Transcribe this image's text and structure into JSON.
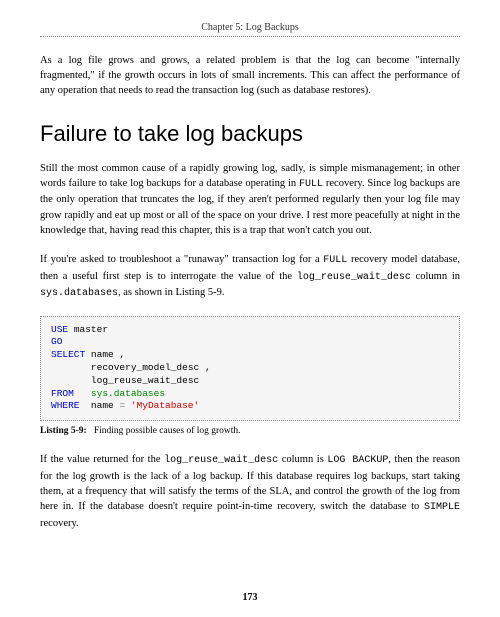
{
  "chapter_header": "Chapter 5: Log Backups",
  "intro": "As a log file grows and grows, a related problem is that the log can become \"internally fragmented,\" if the growth occurs in lots of small increments. This can affect the performance of any operation that needs to read the transaction log (such as database restores).",
  "heading": "Failure to take log backups",
  "para1_a": "Still the most common cause of a rapidly growing log, sadly, is simple mismanagement; in other words failure to take log backups for a database operating in ",
  "para1_code1": "FULL",
  "para1_b": " recovery. Since log backups are the only operation that truncates the log, if they aren't performed regularly then your log file may grow rapidly and eat up most or all of the space on your drive. I rest more peacefully at night in the knowledge that, having read this chapter, this is a trap that won't catch you out.",
  "para2_a": "If you're asked to troubleshoot a \"runaway\" transaction log for a ",
  "para2_code1": "FULL",
  "para2_b": " recovery model database, then a useful first step is to interrogate the value of the ",
  "para2_code2": "log_reuse_wait_desc",
  "para2_c": " column in ",
  "para2_code3": "sys.databases",
  "para2_d": ", as shown in Listing 5-9.",
  "code": {
    "use": "USE",
    "master": "master",
    "go": "GO",
    "select": "SELECT",
    "name_col": "name ,",
    "rmd_col": "recovery_model_desc ,",
    "lrwd_col": "log_reuse_wait_desc",
    "from": "FROM",
    "sysdb": "sys.databases",
    "where": "WHERE",
    "name_eq": "name",
    "eq": "=",
    "mydb": "'MyDatabase'"
  },
  "listing_label": "Listing 5-9:",
  "listing_caption": "Finding possible causes of log growth.",
  "para3_a": "If the value returned for the ",
  "para3_code1": "log_reuse_wait_desc",
  "para3_b": " column is ",
  "para3_code2": "LOG BACKUP",
  "para3_c": ", then the reason for the log growth is the lack of a log backup. If this database requires log backups, start taking them, at a frequency that will satisfy the terms of the SLA, and control the growth of the log from here in. If the database doesn't require point-in-time recovery, switch the database to ",
  "para3_code3": "SIMPLE",
  "para3_d": " recovery.",
  "page_number": "173"
}
